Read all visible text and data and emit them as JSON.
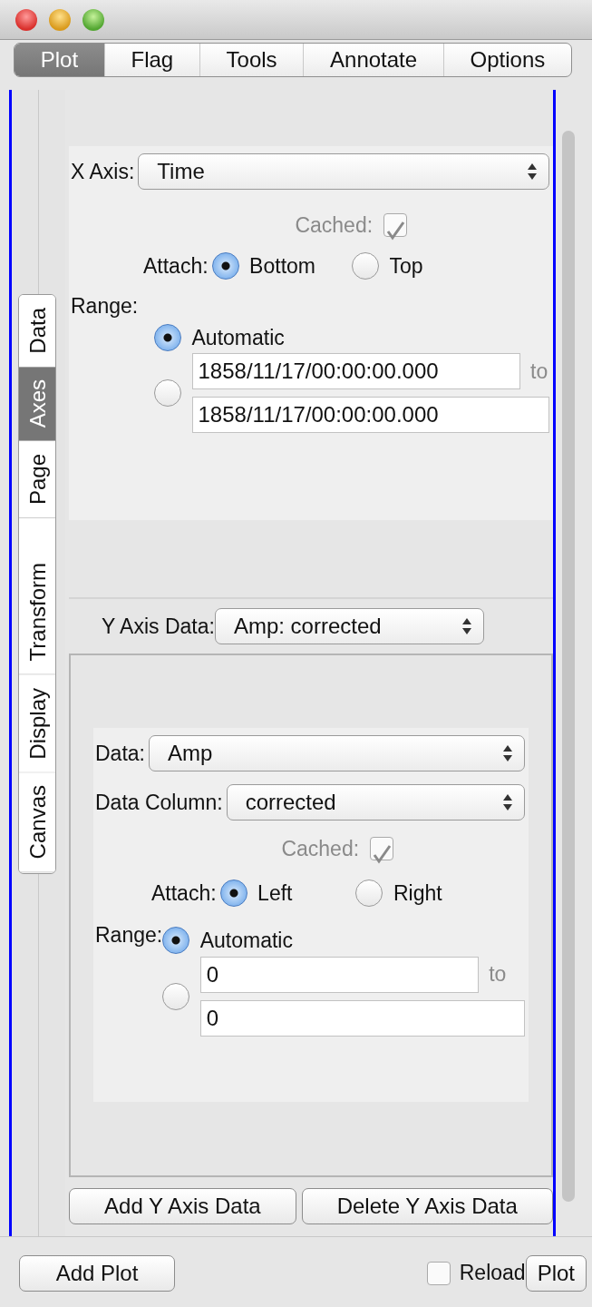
{
  "tabs": [
    {
      "label": "Plot",
      "selected": true
    },
    {
      "label": "Flag",
      "selected": false
    },
    {
      "label": "Tools",
      "selected": false
    },
    {
      "label": "Annotate",
      "selected": false
    },
    {
      "label": "Options",
      "selected": false
    }
  ],
  "side_tabs": [
    {
      "label": "Data",
      "selected": false
    },
    {
      "label": "Axes",
      "selected": true
    },
    {
      "label": "Page",
      "selected": false
    },
    {
      "label": "Transform",
      "selected": false
    },
    {
      "label": "Display",
      "selected": false
    },
    {
      "label": "Canvas",
      "selected": false
    }
  ],
  "x_axis": {
    "label": "X Axis:",
    "value": "Time",
    "cached": {
      "label": "Cached:",
      "checked": true,
      "disabled": true
    },
    "attach": {
      "label": "Attach:",
      "options": [
        {
          "label": "Bottom",
          "selected": true
        },
        {
          "label": "Top",
          "selected": false
        }
      ]
    },
    "range": {
      "label": "Range:",
      "options": [
        {
          "kind": "automatic",
          "label": "Automatic",
          "selected": true
        },
        {
          "kind": "custom",
          "selected": false,
          "from": "1858/11/17/00:00:00.000",
          "separator": "to",
          "to": "1858/11/17/00:00:00.000"
        }
      ]
    }
  },
  "y_axis_data": {
    "label": "Y Axis Data:",
    "value": "Amp: corrected"
  },
  "y_axis": {
    "data": {
      "label": "Data:",
      "value": "Amp"
    },
    "data_column": {
      "label": "Data Column:",
      "value": "corrected"
    },
    "cached": {
      "label": "Cached:",
      "checked": true,
      "disabled": true
    },
    "attach": {
      "label": "Attach:",
      "options": [
        {
          "label": "Left",
          "selected": true
        },
        {
          "label": "Right",
          "selected": false
        }
      ]
    },
    "range": {
      "label": "Range:",
      "options": [
        {
          "kind": "automatic",
          "label": "Automatic",
          "selected": true
        },
        {
          "kind": "custom",
          "selected": false,
          "from": "0",
          "separator": "to",
          "to": "0"
        }
      ]
    }
  },
  "y_buttons": [
    {
      "label": "Add Y Axis Data"
    },
    {
      "label": "Delete Y Axis Data"
    }
  ],
  "footer": {
    "add_plot": "Add Plot",
    "reload": {
      "label": "Reload",
      "checked": false
    },
    "plot": "Plot"
  }
}
